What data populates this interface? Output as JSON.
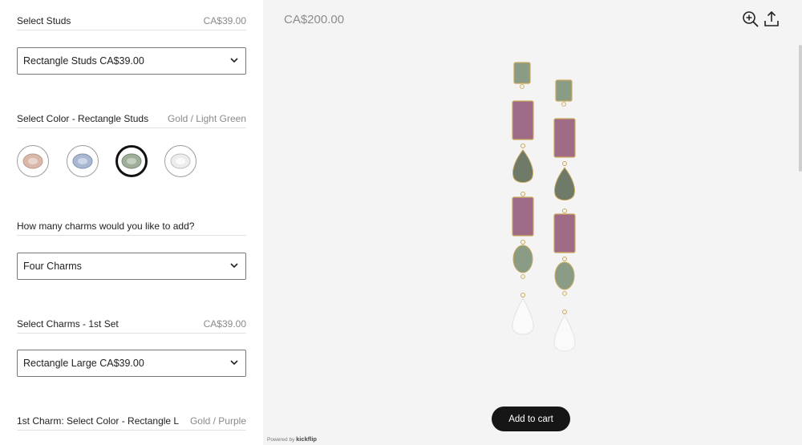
{
  "options": {
    "studs": {
      "label": "Select Studs",
      "price": "CA$39.00",
      "selected": "Rectangle Studs CA$39.00"
    },
    "color": {
      "label": "Select Color - Rectangle Studs",
      "value": "Gold / Light Green"
    },
    "swatches": [
      {
        "name": "peach",
        "color": "#d9b8a8"
      },
      {
        "name": "light-blue",
        "color": "#a9b7d2"
      },
      {
        "name": "light-green",
        "color": "#9fae98",
        "selected": true
      },
      {
        "name": "clear",
        "color": "#e8e8e8"
      }
    ],
    "charms_count": {
      "label": "How many charms would you like to add?",
      "selected": "Four Charms"
    },
    "charms_set1": {
      "label": "Select Charms - 1st Set",
      "price": "CA$39.00",
      "selected": "Rectangle Large CA$39.00"
    },
    "charm1_color": {
      "label": "1st Charm: Select Color - Rectangle L",
      "value": "Gold / Purple"
    }
  },
  "preview": {
    "price": "CA$200.00",
    "add_to_cart": "Add to cart",
    "powered_by": "Powered by",
    "brand": "kickflip"
  },
  "colors": {
    "green_stone": "#8a9c86",
    "purple_stone": "#a06b87",
    "pearl": "#fafafa",
    "accent_button": "#161616"
  }
}
